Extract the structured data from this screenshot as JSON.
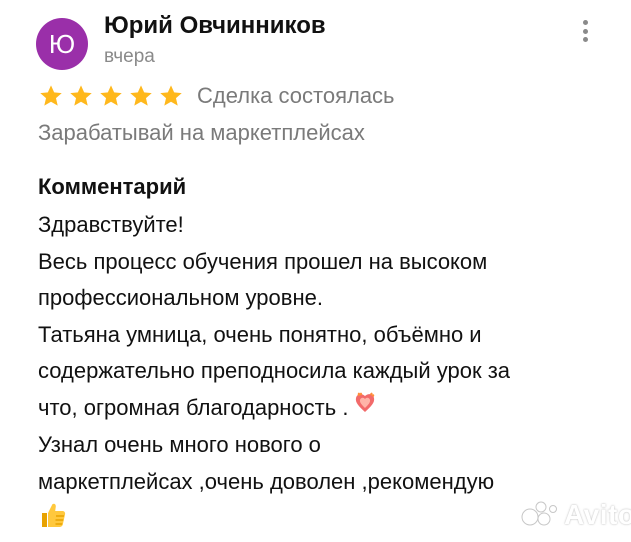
{
  "review": {
    "avatar_letter": "Ю",
    "avatar_color": "#9a2fa9",
    "author": "Юрий Овчинников",
    "date": "вчера",
    "menu_icon": "more-vertical-icon",
    "rating": 5,
    "rating_max": 5,
    "star_color": "#ffb81c",
    "deal_status": "Сделка состоялась",
    "category": "Зарабатывай на маркетплейсах",
    "comment_heading": "Комментарий",
    "comment_lines": [
      "Здравствуйте!",
      "Весь процесс обучения прошел на высоком",
      "профессиональном уровне.",
      "Татьяна умница, очень понятно, объёмно и",
      "содержательно преподносила каждый урок за",
      "что,  огромная благодарность .",
      "Узнал очень много нового о",
      "маркетплейсах ,очень доволен ,рекомендую"
    ],
    "emojis": [
      "heart-on-fire-emoji",
      "thumbs-up-emoji"
    ]
  },
  "watermark": {
    "text": "Avito"
  }
}
